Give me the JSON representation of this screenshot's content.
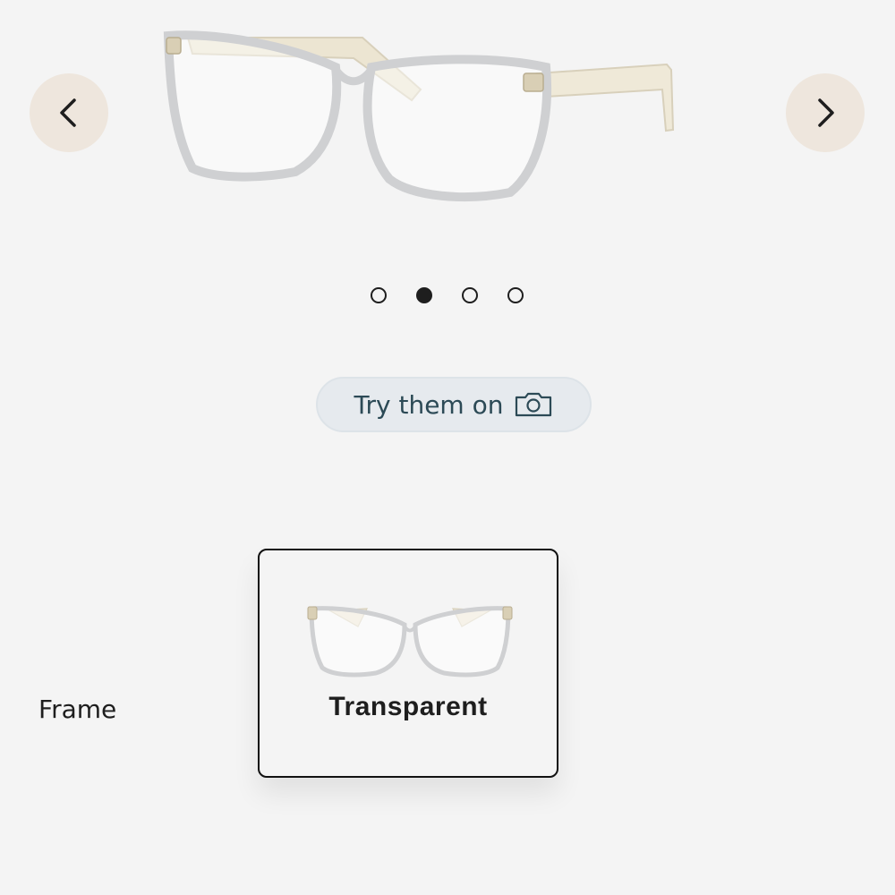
{
  "carousel": {
    "prev_icon": "chevron-left-icon",
    "next_icon": "chevron-right-icon",
    "active_index": 1,
    "total_slides": 4
  },
  "try_on": {
    "label": "Try them on",
    "icon": "camera-icon"
  },
  "frame": {
    "label": "Frame",
    "selected_option": "Transparent"
  },
  "colors": {
    "nav_bg": "#eee6dd",
    "try_on_text": "#2c4a56",
    "background": "#f4f4f4"
  }
}
